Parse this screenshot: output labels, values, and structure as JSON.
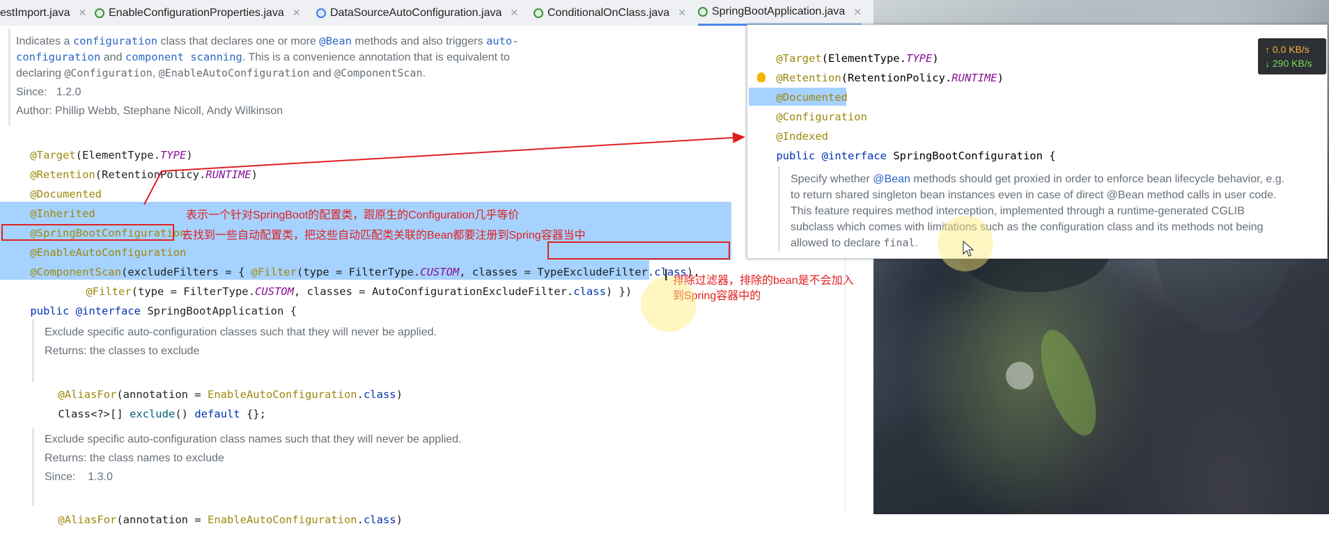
{
  "tabs": [
    {
      "label": "estImport.java",
      "icon": "java-annotation-icon",
      "color": "#3c8f3c"
    },
    {
      "label": "EnableConfigurationProperties.java",
      "icon": "annotation-icon",
      "color": "#3c8f3c"
    },
    {
      "label": "DataSourceAutoConfiguration.java",
      "icon": "class-icon",
      "color": "#3d7be0"
    },
    {
      "label": "ConditionalOnClass.java",
      "icon": "annotation-icon",
      "color": "#3c8f3c"
    },
    {
      "label": "SpringBootApplication.java",
      "icon": "annotation-icon",
      "color": "#3c8f3c"
    }
  ],
  "doc_top": {
    "line1_a": "Indicates a ",
    "line1_kw1": "configuration",
    "line1_b": " class that declares one or more ",
    "line1_kw2": "@Bean",
    "line1_c": " methods and also triggers ",
    "line1_kw3": "auto-",
    "line2_kw1": "configuration",
    "line2_a": " and ",
    "line2_kw2": "component scanning",
    "line2_b": ". This is a convenience annotation that is equivalent to",
    "line3_a": "declaring ",
    "line3_m1": "@Configuration",
    "line3_b": ", ",
    "line3_m2": "@EnableAutoConfiguration",
    "line3_c": " and ",
    "line3_m3": "@ComponentScan",
    "line3_d": ".",
    "since_label": "Since:",
    "since_value": "1.2.0",
    "author": "Author: Phillip Webb, Stephane Nicoll, Andy Wilkinson"
  },
  "code": {
    "target": "@Target",
    "target_args_a": "(ElementType.",
    "target_type": "TYPE",
    "target_args_b": ")",
    "retention": "@Retention",
    "retention_a": "(RetentionPolicy.",
    "retention_val": "RUNTIME",
    "retention_b": ")",
    "documented": "@Documented",
    "inherited": "@Inherited",
    "sbc": "@SpringBootConfiguration",
    "eac": "@EnableAutoConfiguration",
    "cs": "@ComponentScan",
    "cs_a": "(excludeFilters = { ",
    "filter": "@Filter",
    "cs_b": "(type = FilterType.",
    "custom": "CUSTOM",
    "cs_c": ", classes = ",
    "tef": "TypeExcludeFilter.",
    "class_kw": "class",
    "cs_d": "),",
    "cs_e": ", classes = AutoConfigurationExcludeFilter.",
    "cs_f": ") })",
    "public": "public ",
    "interface": "@interface",
    "name": " SpringBootApplication",
    "brace": " {",
    "alias": "@AliasFor",
    "alias_a": "(annotation = ",
    "eac_ref": "EnableAutoConfiguration",
    "alias_b": ".",
    "alias_c": ")",
    "exclude_a": "Class<?>[] ",
    "exclude_m": "exclude",
    "exclude_b": "() ",
    "default": "default",
    "exclude_c": " {};"
  },
  "doc_exclude": {
    "desc": "Exclude specific auto-configuration classes such that they will never be applied.",
    "returns": "Returns: the classes to exclude"
  },
  "doc_exclude_name": {
    "desc": "Exclude specific auto-configuration class names such that they will never be applied.",
    "returns": "Returns: the class names to exclude",
    "since_label": "Since:",
    "since_value": "1.3.0"
  },
  "notes": {
    "sbc": "表示一个针对SpringBoot的配置类，跟原生的Configuration几乎等价",
    "eac": "去找到一些自动配置类，把这些自动匹配类关联的Bean都要注册到Spring容器当中",
    "filter_1": "排除过滤器，排除的bean是不会加入",
    "filter_2": "到Spring容器中的"
  },
  "popup": {
    "target": "@Target",
    "target_a": "(ElementType.",
    "target_type": "TYPE",
    "target_b": ")",
    "retention": "@Retention",
    "retention_a": "(RetentionPolicy.",
    "retention_val": "RUNTIME",
    "retention_b": ")",
    "documented": "@Documented",
    "configuration": "@Configuration",
    "indexed": "@Indexed",
    "public": "public ",
    "interface": "@interface",
    "name": " SpringBootConfiguration",
    "brace": " {",
    "doc_1a": "Specify whether ",
    "doc_1kw": "@Bean",
    "doc_1b": " methods should get proxied in order to enforce bean lifecycle behavior, e.g.",
    "doc_2a": "to return shared singleton bean instances even in case of direct ",
    "doc_2m": "@Bean",
    "doc_2b": " method calls in user code.",
    "doc_3": "This feature requires method interception, implemented through a runtime-generated CGLIB",
    "doc_4": "subclass which comes with limitations such as the configuration class and its methods not being",
    "doc_5a": "allowed to declare ",
    "doc_5m": "final",
    "doc_5b": "."
  },
  "speed": {
    "up": "↑ 0.0 KB/s",
    "down": "↓ 290 KB/s"
  },
  "colors": {
    "annotation": "#9e880d",
    "keyword": "#0033b3",
    "italic_const": "#871094",
    "selection": "#a6d2ff",
    "red_annotation": "#e02020"
  }
}
